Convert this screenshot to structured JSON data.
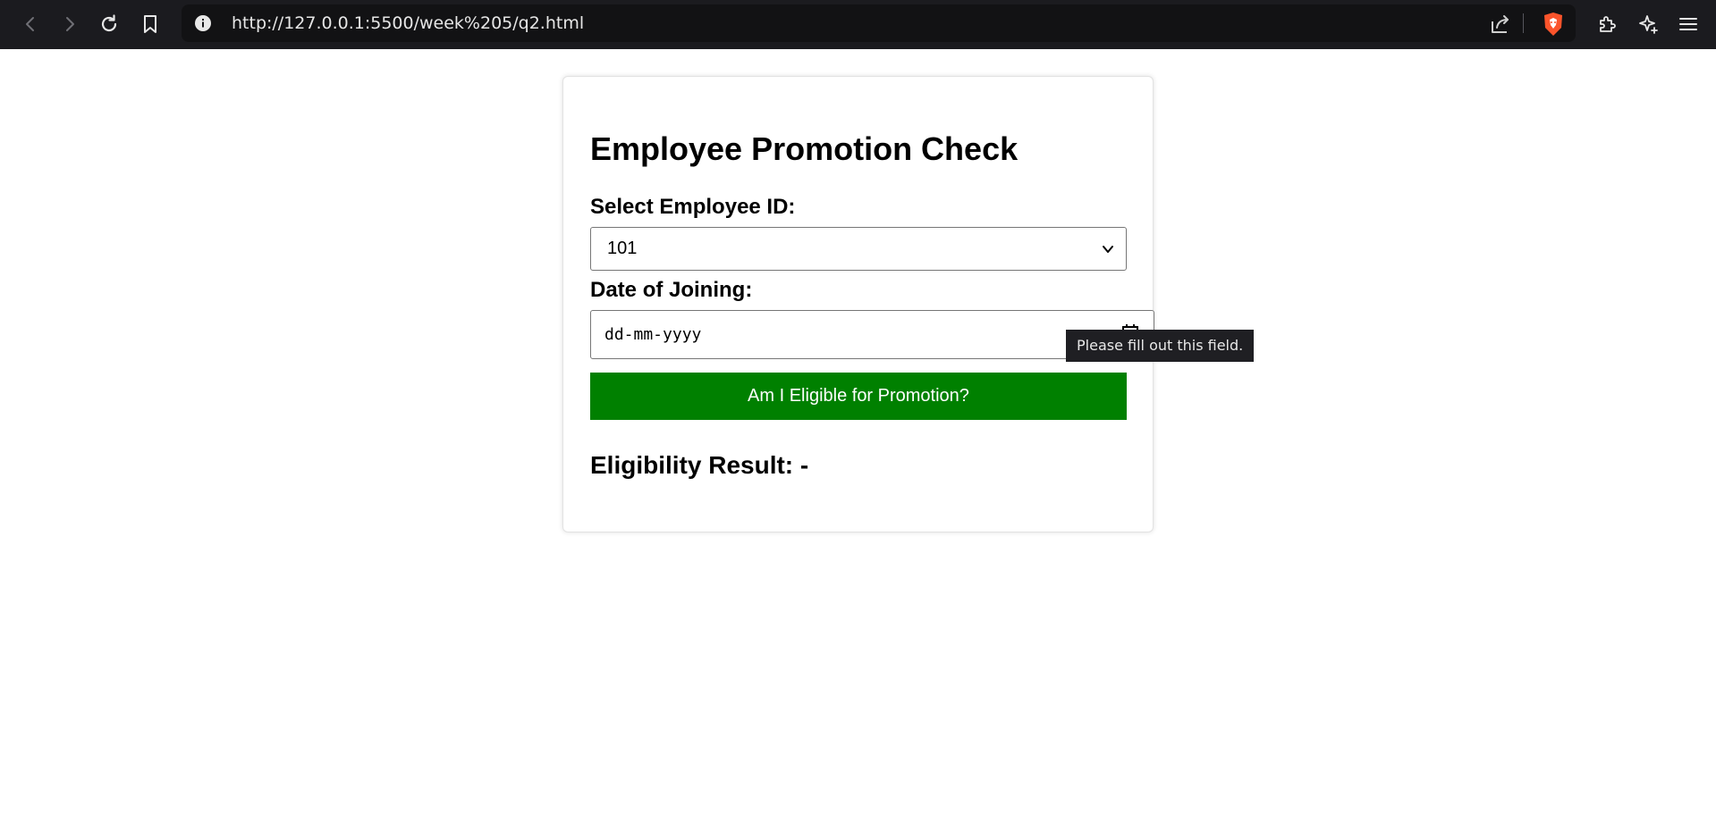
{
  "browser": {
    "url": "http://127.0.0.1:5500/week%205/q2.html",
    "icons": [
      "back-icon",
      "forward-icon",
      "reload-icon",
      "bookmark-icon",
      "info-icon",
      "share-icon",
      "brave-shield-icon",
      "extensions-icon",
      "leo-ai-icon",
      "menu-icon"
    ],
    "colors": {
      "toolbar": "#1b1b1f",
      "urlbar": "#121214",
      "shield": "#fb542b"
    }
  },
  "page": {
    "title": "Employee Promotion Check",
    "employee_label": "Select Employee ID:",
    "employee_selected": "101",
    "doj_label": "Date of Joining:",
    "doj_placeholder": "dd-mm-yyyy",
    "submit_label": "Am I Eligible for Promotion?",
    "result_text": "Eligibility Result: -",
    "colors": {
      "button": "#008000",
      "button_text": "#ffffff"
    }
  },
  "tooltip": {
    "text": "Please fill out this field."
  }
}
